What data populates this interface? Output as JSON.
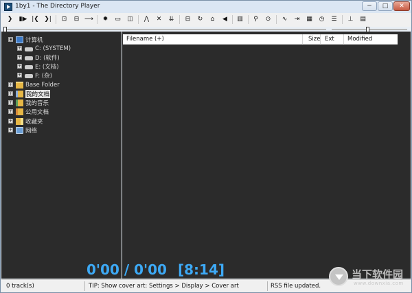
{
  "window": {
    "title": "1by1 - The Directory Player",
    "controls": {
      "minimize": "─",
      "maximize": "□",
      "close": "✕"
    }
  },
  "toolbar": {
    "buttons": [
      {
        "name": "play-icon",
        "glyph": "❯"
      },
      {
        "name": "pause-icon",
        "glyph": "▮▶"
      },
      {
        "name": "previous-icon",
        "glyph": "|❮"
      },
      {
        "name": "next-icon",
        "glyph": "❯|"
      },
      {
        "name": "open-folder-icon",
        "glyph": "⊡"
      },
      {
        "name": "folder-up-icon",
        "glyph": "⊟"
      },
      {
        "name": "forward-arrow-icon",
        "glyph": "⟶"
      },
      {
        "name": "settings-gear-icon",
        "glyph": "✹"
      },
      {
        "name": "display-icon",
        "glyph": "▭"
      },
      {
        "name": "panel-icon",
        "glyph": "◫"
      },
      {
        "name": "up-icon",
        "glyph": "⋀"
      },
      {
        "name": "stop-icon",
        "glyph": "✕"
      },
      {
        "name": "sort-icon",
        "glyph": "⇊"
      },
      {
        "name": "window-icon",
        "glyph": "⊟"
      },
      {
        "name": "repeat-icon",
        "glyph": "↻"
      },
      {
        "name": "home-icon",
        "glyph": "⌂"
      },
      {
        "name": "volume-icon",
        "glyph": "◀"
      },
      {
        "name": "library-icon",
        "glyph": "▥"
      },
      {
        "name": "search-icon",
        "glyph": "⚲"
      },
      {
        "name": "find-icon",
        "glyph": "⊙"
      },
      {
        "name": "waveform-icon",
        "glyph": "∿"
      },
      {
        "name": "export-icon",
        "glyph": "⇥"
      },
      {
        "name": "equalizer-icon",
        "glyph": "▦"
      },
      {
        "name": "clock-icon",
        "glyph": "◷"
      },
      {
        "name": "sliders-icon",
        "glyph": "☰"
      },
      {
        "name": "slider-control-icon",
        "glyph": "⊥"
      },
      {
        "name": "layout-icon",
        "glyph": "▤"
      }
    ]
  },
  "tree": {
    "items": [
      {
        "name": "tree-item-computer",
        "label": "计算机",
        "expander": "▪",
        "icon": "computer-icon",
        "selected": false
      },
      {
        "name": "tree-item-drive-c",
        "label": "C: (SYSTEM)",
        "expander": "+",
        "icon": "drive-icon",
        "selected": false
      },
      {
        "name": "tree-item-drive-d",
        "label": "D: (软件)",
        "expander": "+",
        "icon": "drive-icon",
        "selected": false
      },
      {
        "name": "tree-item-drive-e",
        "label": "E: (文档)",
        "expander": "+",
        "icon": "drive-icon",
        "selected": false
      },
      {
        "name": "tree-item-drive-f",
        "label": "F: (杂)",
        "expander": "+",
        "icon": "drive-icon",
        "selected": false
      },
      {
        "name": "tree-item-base-folder",
        "label": "Base Folder",
        "expander": "+",
        "icon": "folder-icon",
        "selected": false
      },
      {
        "name": "tree-item-my-documents",
        "label": "我的文档",
        "expander": "+",
        "icon": "documents-folder-icon",
        "selected": true
      },
      {
        "name": "tree-item-my-music",
        "label": "我的音乐",
        "expander": "+",
        "icon": "music-folder-icon",
        "selected": false
      },
      {
        "name": "tree-item-public-documents",
        "label": "公用文档",
        "expander": "+",
        "icon": "public-folder-icon",
        "selected": false
      },
      {
        "name": "tree-item-favorites",
        "label": "收藏夹",
        "expander": "+",
        "icon": "favorites-folder-icon",
        "selected": false
      },
      {
        "name": "tree-item-network",
        "label": "网络",
        "expander": "+",
        "icon": "network-icon",
        "selected": false
      }
    ]
  },
  "file_list": {
    "columns": {
      "filename": "Filename (+)",
      "size": "Size",
      "ext": "Ext",
      "modified": "Modified"
    }
  },
  "player": {
    "position": "0'00 / 0'00",
    "total_duration": "[8:14]",
    "seek_fraction": 0,
    "volume_fraction": 0.48
  },
  "status": {
    "tracks": "0 track(s)",
    "tip": "TIP: Show cover art: Settings > Display > Cover art",
    "rss": "RSS file updated."
  },
  "watermark": {
    "title": "当下软件园",
    "url": "www.downxia.com"
  },
  "colors": {
    "pane_background": "#2b2b2b",
    "time_display": "#3da9f5"
  }
}
